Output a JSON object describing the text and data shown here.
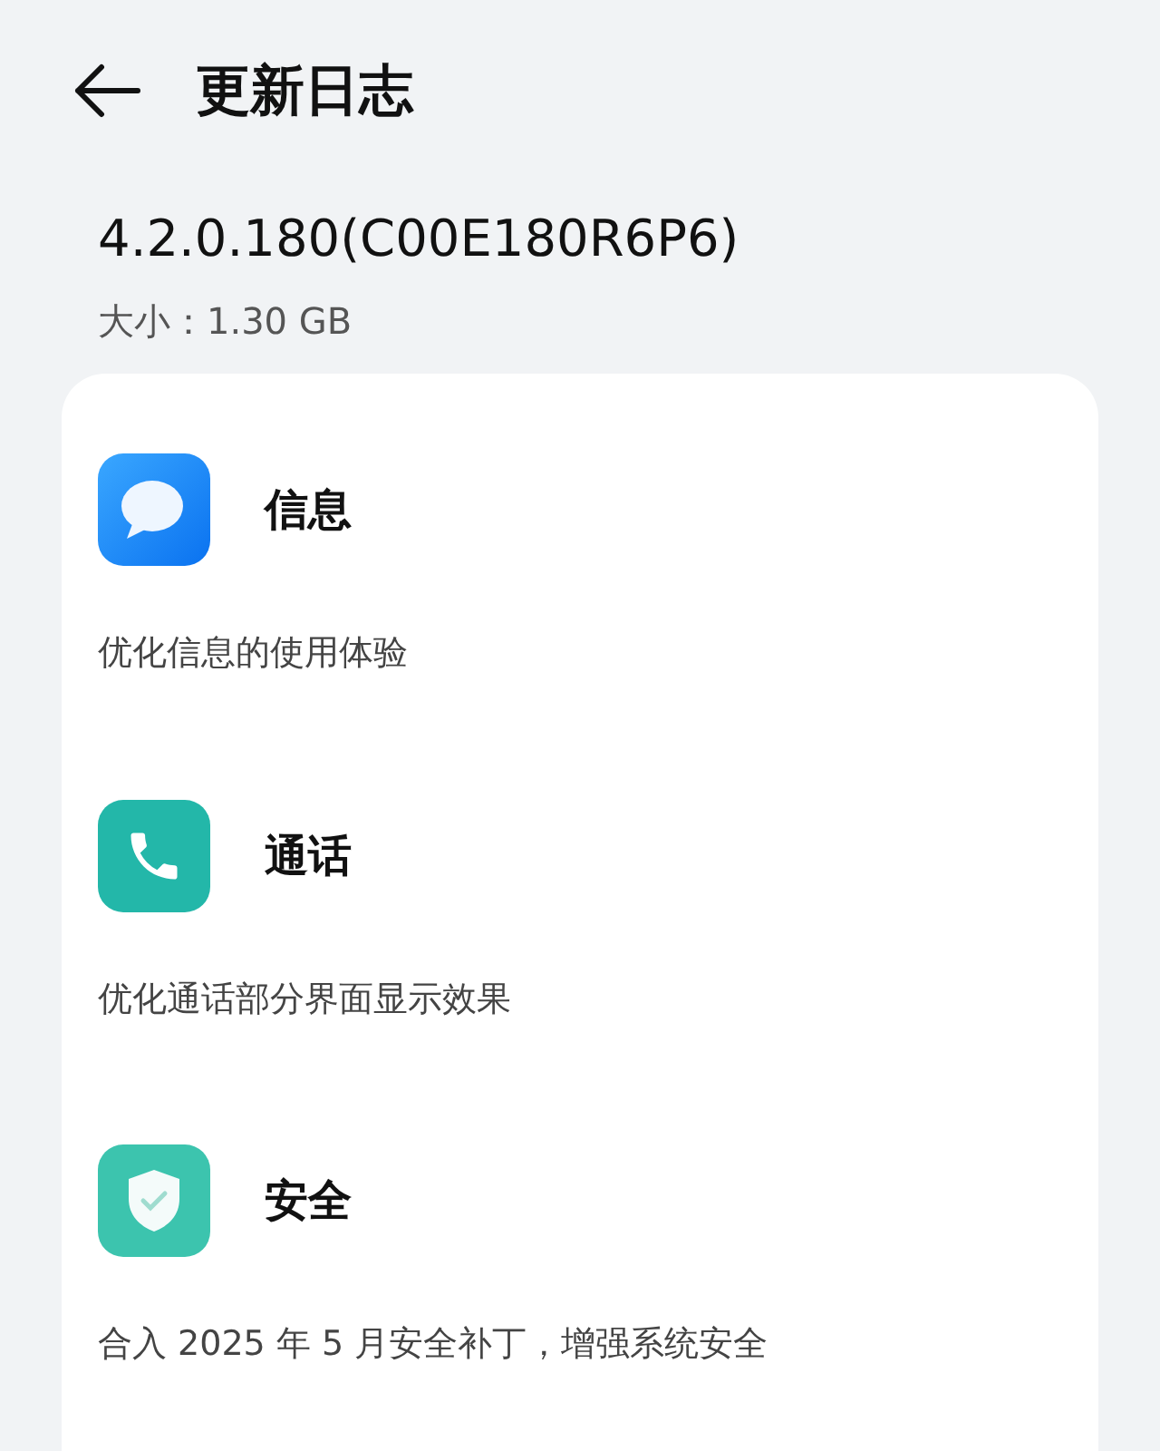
{
  "header": {
    "title": "更新日志"
  },
  "version": "4.2.0.180(C00E180R6P6)",
  "size": "大小：1.30 GB",
  "items": [
    {
      "kind": "message",
      "title": "信息",
      "description": "优化信息的使用体验"
    },
    {
      "kind": "call",
      "title": "通话",
      "description": "优化通话部分界面显示效果"
    },
    {
      "kind": "security",
      "title": "安全",
      "description": "合入 2025 年 5 月安全补丁，增强系统安全"
    }
  ]
}
